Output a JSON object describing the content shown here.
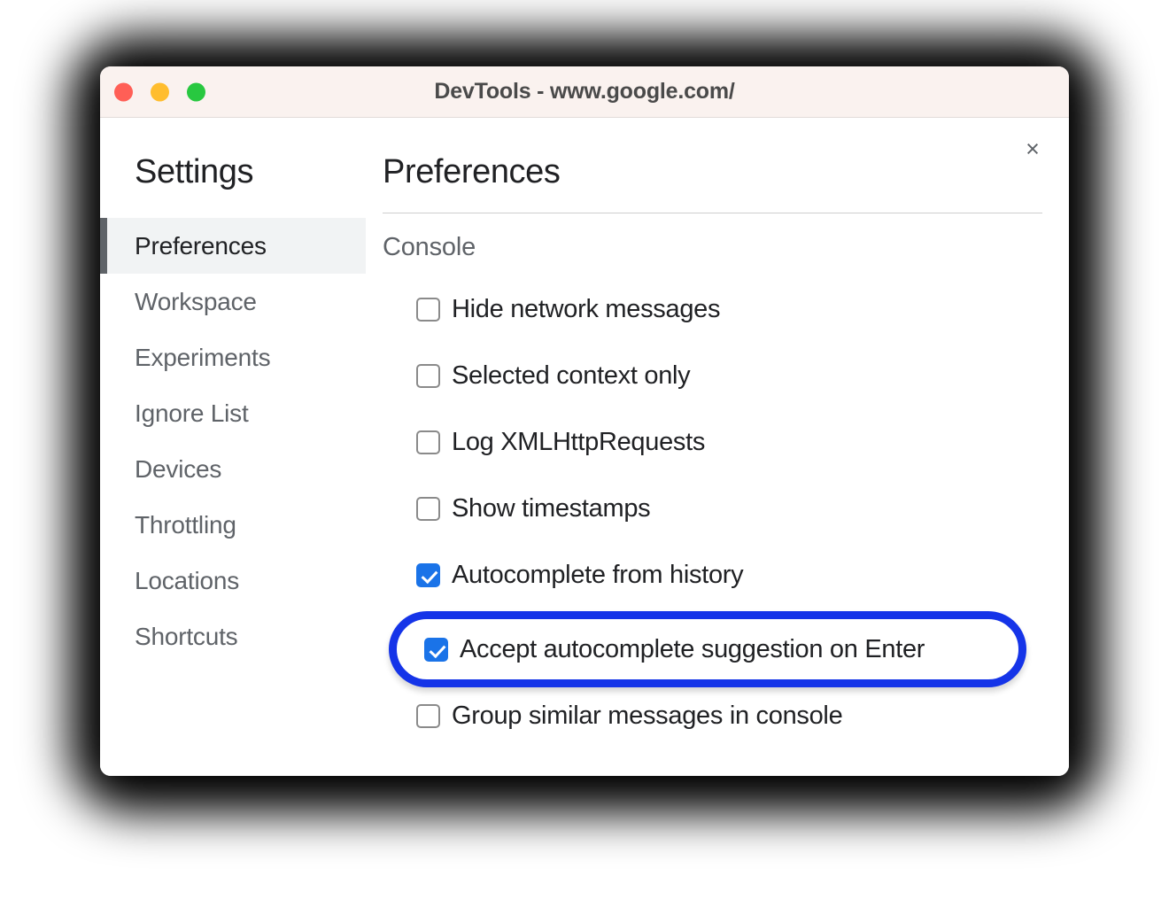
{
  "window": {
    "title": "DevTools - www.google.com/",
    "traffic_lights": [
      {
        "name": "close",
        "color": "#FF5F56"
      },
      {
        "name": "minimize",
        "color": "#FFBD2E"
      },
      {
        "name": "maximize",
        "color": "#28C840"
      }
    ],
    "close_icon": "×"
  },
  "sidebar": {
    "heading": "Settings",
    "items": [
      {
        "label": "Preferences",
        "selected": true
      },
      {
        "label": "Workspace",
        "selected": false
      },
      {
        "label": "Experiments",
        "selected": false
      },
      {
        "label": "Ignore List",
        "selected": false
      },
      {
        "label": "Devices",
        "selected": false
      },
      {
        "label": "Throttling",
        "selected": false
      },
      {
        "label": "Locations",
        "selected": false
      },
      {
        "label": "Shortcuts",
        "selected": false
      }
    ]
  },
  "main": {
    "heading": "Preferences",
    "section_heading": "Console",
    "checkboxes": [
      {
        "label": "Hide network messages",
        "checked": false,
        "highlighted": false
      },
      {
        "label": "Selected context only",
        "checked": false,
        "highlighted": false
      },
      {
        "label": "Log XMLHttpRequests",
        "checked": false,
        "highlighted": false
      },
      {
        "label": "Show timestamps",
        "checked": false,
        "highlighted": false
      },
      {
        "label": "Autocomplete from history",
        "checked": true,
        "highlighted": false
      },
      {
        "label": "Accept autocomplete suggestion on Enter",
        "checked": true,
        "highlighted": true
      },
      {
        "label": "Group similar messages in console",
        "checked": false,
        "highlighted": false
      }
    ]
  },
  "colors": {
    "titlebar_bg": "#FAF2EF",
    "accent_checkbox": "#1A73E8",
    "highlight_ring": "#1534E8",
    "selected_nav_bg": "#F1F3F4",
    "selected_nav_bar": "#5F6368",
    "text_primary": "#202124",
    "text_secondary": "#5F6368"
  }
}
